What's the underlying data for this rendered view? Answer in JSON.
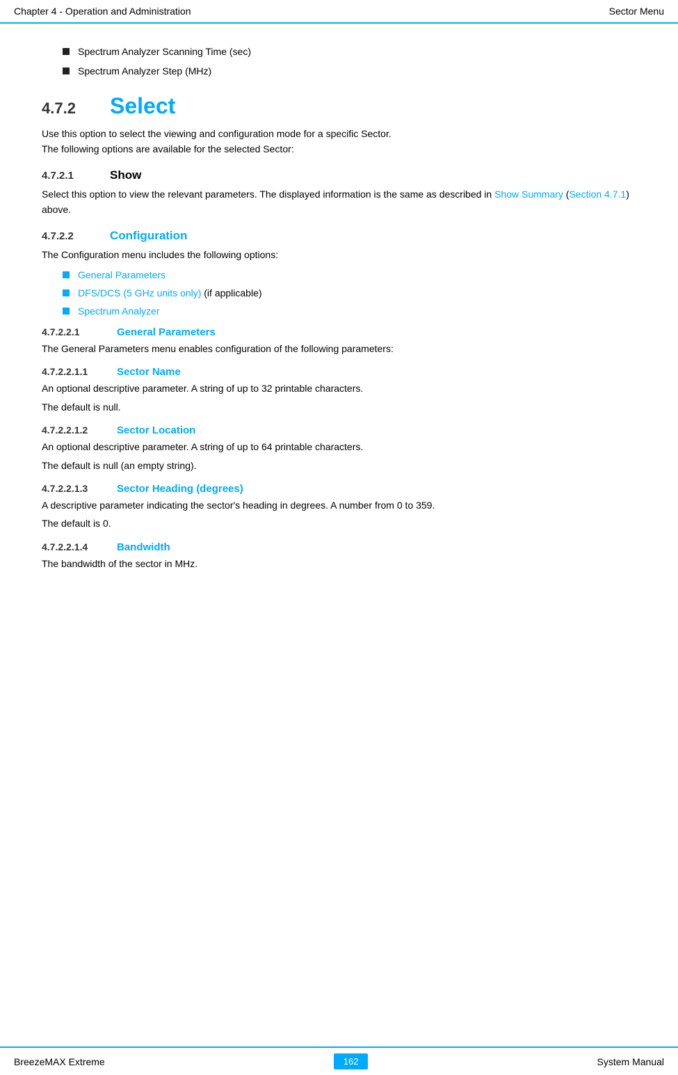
{
  "header": {
    "left": "Chapter 4 - Operation and Administration",
    "right": "Sector Menu"
  },
  "footer": {
    "left": "BreezeMAX Extreme",
    "center": "162",
    "right": "System Manual"
  },
  "intro_bullets": [
    "Spectrum Analyzer Scanning Time (sec)",
    "Spectrum Analyzer Step (MHz)"
  ],
  "section472": {
    "num": "4.7.2",
    "title": "Select",
    "desc1": "Use this option to select the viewing and configuration mode for a specific Sector.",
    "desc2": "The following options are available for the selected Sector:"
  },
  "section4721": {
    "num": "4.7.2.1",
    "title": "Show",
    "desc": "Select this option to view the relevant parameters. The displayed information is the same as described in Show Summary (Section 4.7.1) above."
  },
  "section4722": {
    "num": "4.7.2.2",
    "title": "Configuration",
    "desc": "The Configuration menu includes the following options:"
  },
  "config_bullets": [
    {
      "text": "General Parameters",
      "blue": true
    },
    {
      "text": "DFS/DCS (5 GHz units only)",
      "blue": true,
      "suffix": " (if applicable)"
    },
    {
      "text": "Spectrum Analyzer",
      "blue": true
    }
  ],
  "section47221": {
    "num": "4.7.2.2.1",
    "title": "General Parameters",
    "desc": "The General Parameters menu enables configuration of the following parameters:"
  },
  "section472211": {
    "num": "4.7.2.2.1.1",
    "title": "Sector Name",
    "desc1": "An optional descriptive parameter. A string of up to 32 printable characters.",
    "desc2": "The default is null."
  },
  "section472212": {
    "num": "4.7.2.2.1.2",
    "title": "Sector Location",
    "desc1": "An optional descriptive parameter. A string of up to 64 printable characters.",
    "desc2": "The default is null (an empty string)."
  },
  "section472213": {
    "num": "4.7.2.2.1.3",
    "title": "Sector Heading (degrees)",
    "desc1": "A descriptive parameter indicating the sector's heading in degrees. A number from 0 to 359.",
    "desc2": "The default is 0."
  },
  "section472214": {
    "num": "4.7.2.2.1.4",
    "title": "Bandwidth",
    "desc1": "The bandwidth of the sector in MHz."
  }
}
